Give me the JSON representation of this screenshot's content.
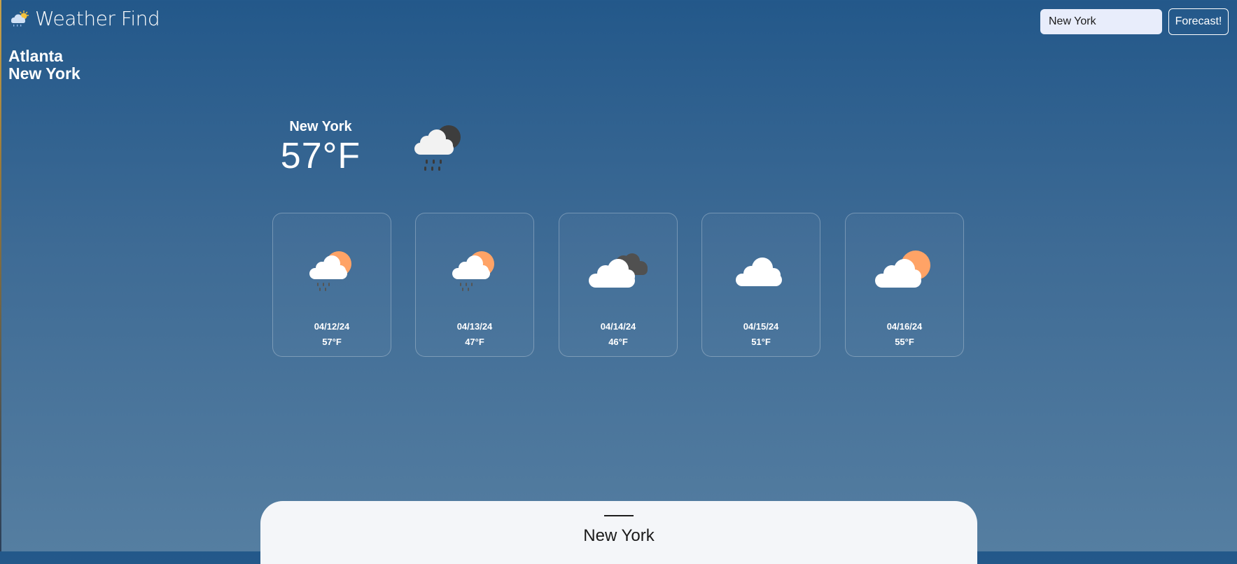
{
  "app": {
    "title": "Weather Find",
    "logo_icon": "sun-behind-cloud-rain-icon"
  },
  "search": {
    "value": "New York",
    "button_label": "Forecast!"
  },
  "history": {
    "items": [
      "Atlanta",
      "New York"
    ]
  },
  "current": {
    "city": "New York",
    "temp": "57°F",
    "icon": "cloud-rain-moon-icon"
  },
  "forecast": [
    {
      "date": "04/12/24",
      "temp": "57°F",
      "icon": "cloud-sun-rain-icon"
    },
    {
      "date": "04/13/24",
      "temp": "47°F",
      "icon": "cloud-sun-rain-icon"
    },
    {
      "date": "04/14/24",
      "temp": "46°F",
      "icon": "cloud-dark-cloud-icon"
    },
    {
      "date": "04/15/24",
      "temp": "51°F",
      "icon": "cloud-icon"
    },
    {
      "date": "04/16/24",
      "temp": "55°F",
      "icon": "cloud-sun-icon"
    }
  ],
  "panel": {
    "title": "New York"
  },
  "colors": {
    "background_top": "#23588a",
    "background_bottom": "#557ea1",
    "sun": "#ffa366",
    "dark_cloud": "#505050",
    "input_bg": "#e8edfb"
  }
}
